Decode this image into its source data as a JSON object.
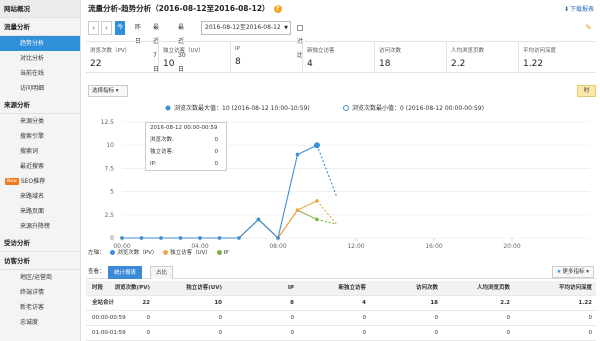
{
  "sidebar": {
    "sections": [
      {
        "title": "网站概况",
        "items": []
      },
      {
        "title": "流量分析",
        "items": [
          "趋势分析",
          "对比分析",
          "当前在线",
          "访问明细"
        ]
      },
      {
        "title": "来源分析",
        "items": [
          "来源分类",
          "搜索引擎",
          "搜索词",
          "最近搜索",
          "SEO推荐",
          "来路域名",
          "来路页面",
          "来源升降榜"
        ]
      },
      {
        "title": "受访分析",
        "items": []
      },
      {
        "title": "访客分析",
        "items": [
          "地区/运营商",
          "终端详情",
          "新老访客",
          "忠诚度"
        ]
      }
    ],
    "active_item": "趋势分析",
    "new_badge": "New"
  },
  "header": {
    "title": "流量分析-趋势分析（2016-08-12至2016-08-12）",
    "help": "?",
    "download": "下载报表"
  },
  "date_bar": {
    "prev": "‹",
    "next": "›",
    "buttons": [
      "今日",
      "昨日",
      "最近7日",
      "最近30日"
    ],
    "active_button": "今日",
    "range": "2016-08-12至2016-08-12",
    "compare_label": "对比"
  },
  "metrics": [
    {
      "label": "浏览次数（PV）",
      "value": "22"
    },
    {
      "label": "独立访客（UV）",
      "value": "10"
    },
    {
      "label": "IP",
      "value": "8"
    },
    {
      "label": "新独立访客",
      "value": "4"
    },
    {
      "label": "访问次数",
      "value": "18"
    },
    {
      "label": "人均浏览页数",
      "value": "2.2"
    },
    {
      "label": "平均访问深度",
      "value": "1.22"
    }
  ],
  "chart_controls": {
    "select_metric": "选择指标",
    "hour_button": "时"
  },
  "chart_data": {
    "type": "line",
    "annotations": {
      "max": "浏览次数最大值：10 (2016-08-12 10:00-10:59)",
      "min": "浏览次数最小值：0 (2016-08-12 00:00-00:59)"
    },
    "x_tick_labels": [
      "00:00",
      "04:00",
      "08:00",
      "12:00",
      "16:00",
      "20:00"
    ],
    "y_tick_labels": [
      "0",
      "2.5",
      "5",
      "7.5",
      "10",
      "12.5"
    ],
    "ylim": [
      0,
      12.5
    ],
    "xlim": [
      0,
      24
    ],
    "x": [
      0,
      1,
      2,
      3,
      4,
      5,
      6,
      7,
      8,
      9,
      10,
      11
    ],
    "series": [
      {
        "name": "浏览次数（PV）",
        "color": "#3b8fd8",
        "values": [
          0,
          0,
          0,
          0,
          0,
          0,
          0,
          2,
          0,
          9,
          10,
          4.5
        ]
      },
      {
        "name": "独立访客（UV）",
        "color": "#f0a541",
        "values": [
          0,
          0,
          0,
          0,
          0,
          0,
          0,
          2,
          0,
          3,
          4,
          1.5
        ]
      },
      {
        "name": "IP",
        "color": "#7cb342",
        "values": [
          0,
          0,
          0,
          0,
          0,
          0,
          0,
          2,
          0,
          3,
          2,
          1.5
        ]
      }
    ],
    "dashed_from_x": 10,
    "grid": true,
    "legend_placement": "bottom-left",
    "legend_title": "左轴："
  },
  "tooltip": {
    "title": "2016-08-12 00:00-00:59",
    "rows": [
      {
        "label": "浏览次数:",
        "value": "0"
      },
      {
        "label": "独立访客:",
        "value": "0"
      },
      {
        "label": "IP:",
        "value": "0"
      }
    ]
  },
  "view": {
    "label": "查看：",
    "tabs": [
      "统计报表",
      "占比"
    ],
    "active_tab": "统计报表",
    "more": "更多指标"
  },
  "table": {
    "headers": [
      "时段",
      "浏览次数(PV)",
      "独立访客(UV)",
      "IP",
      "新独立访客",
      "访问次数",
      "人均浏览页数",
      "平均访问深度"
    ],
    "rows": [
      [
        "全站合计",
        "22",
        "10",
        "8",
        "4",
        "18",
        "2.2",
        "1.22"
      ],
      [
        "00:00-00:59",
        "0",
        "0",
        "0",
        "0",
        "0",
        "0",
        "0"
      ],
      [
        "01:00-01:59",
        "0",
        "0",
        "0",
        "0",
        "0",
        "0",
        "0"
      ]
    ]
  },
  "colors": {
    "accent": "#2f8fd8",
    "pv": "#3b8fd8",
    "uv": "#f0a541",
    "ip": "#7cb342"
  }
}
